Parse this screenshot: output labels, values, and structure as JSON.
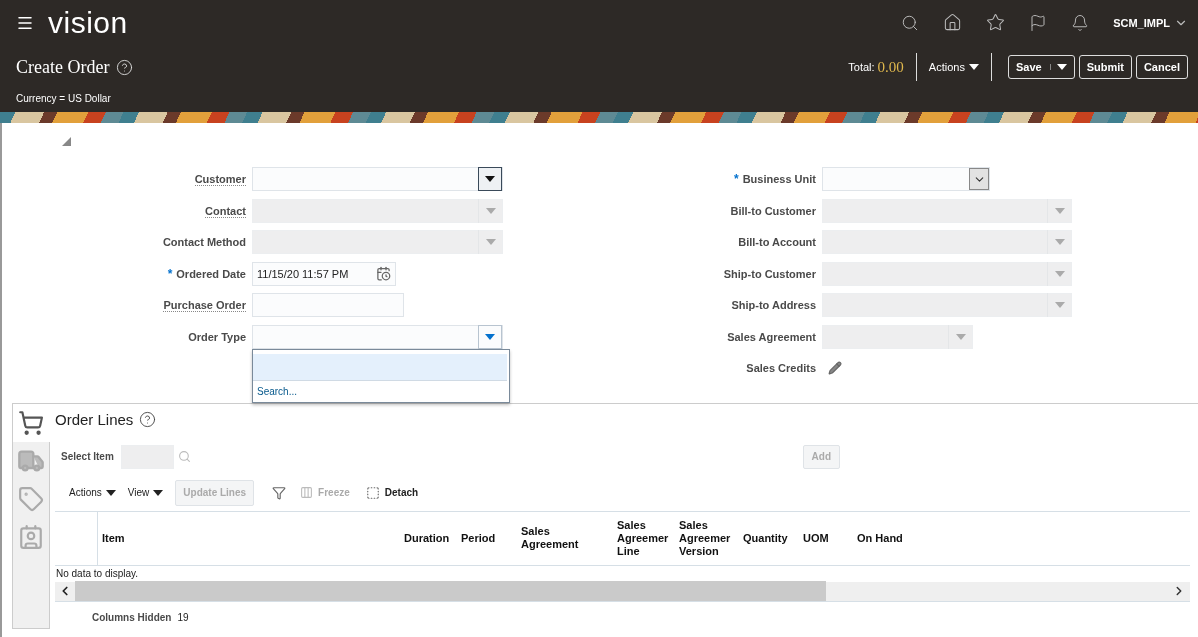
{
  "header": {
    "logo": "vision",
    "user": "SCM_IMPL"
  },
  "page": {
    "title": "Create Order",
    "total_label": "Total:",
    "total_value": "0.00",
    "actions_menu": "Actions",
    "currency": "Currency = US Dollar",
    "buttons": [
      {
        "label": "Save",
        "kind": "split"
      },
      {
        "label": "Submit",
        "kind": "plain"
      },
      {
        "label": "Cancel",
        "kind": "plain"
      }
    ]
  },
  "form": {
    "required_mark": "*",
    "left": [
      {
        "label": "Customer",
        "kind": "select",
        "required": false,
        "help": true,
        "disabled": false,
        "hovered": true,
        "open": false
      },
      {
        "label": "Contact",
        "kind": "select",
        "required": false,
        "help": true,
        "disabled": true,
        "hovered": false,
        "open": false
      },
      {
        "label": "Contact Method",
        "kind": "select",
        "required": false,
        "help": false,
        "disabled": true,
        "hovered": false,
        "open": false
      },
      {
        "label": "Ordered Date",
        "kind": "date",
        "required": true,
        "help": false,
        "disabled": false,
        "value": "11/15/20 11:57 PM"
      },
      {
        "label": "Purchase Order",
        "kind": "text",
        "required": false,
        "help": true,
        "disabled": false
      },
      {
        "label": "Order Type",
        "kind": "select",
        "required": false,
        "help": false,
        "disabled": false,
        "hovered": false,
        "open": true,
        "menu_link": "Search..."
      }
    ],
    "right": [
      {
        "label": "Business Unit",
        "kind": "combo",
        "required": true,
        "help": false,
        "disabled": false
      },
      {
        "label": "Bill-to Customer",
        "kind": "select",
        "required": false,
        "help": false,
        "disabled": true,
        "hovered": false,
        "open": false
      },
      {
        "label": "Bill-to Account",
        "kind": "select",
        "required": false,
        "help": false,
        "disabled": true,
        "hovered": false,
        "open": false
      },
      {
        "label": "Ship-to Customer",
        "kind": "select",
        "required": false,
        "help": false,
        "disabled": true,
        "hovered": false,
        "open": false
      },
      {
        "label": "Ship-to Address",
        "kind": "select",
        "required": false,
        "help": false,
        "disabled": true,
        "hovered": false,
        "open": false
      },
      {
        "label": "Sales Agreement",
        "kind": "select",
        "required": false,
        "help": false,
        "disabled": true,
        "hovered": false,
        "open": false
      },
      {
        "label": "Sales Credits",
        "kind": "edit",
        "required": false,
        "help": false
      }
    ]
  },
  "order_lines": {
    "title": "Order Lines",
    "side_tabs": [
      {
        "kind": "cart",
        "selected": true
      },
      {
        "kind": "truck",
        "selected": false
      },
      {
        "kind": "tag",
        "selected": false
      },
      {
        "kind": "contact",
        "selected": false
      }
    ],
    "select_item_label": "Select Item",
    "add_button": {
      "label": "Add",
      "disabled": true
    },
    "toolbar": [
      {
        "kind": "menu",
        "label": "Actions",
        "disabled": false
      },
      {
        "kind": "menu",
        "label": "View",
        "disabled": false
      },
      {
        "kind": "button",
        "label": "Update Lines",
        "disabled": true
      },
      {
        "kind": "filter",
        "disabled": false
      },
      {
        "kind": "freeze",
        "label": "Freeze",
        "disabled": true
      },
      {
        "kind": "detach",
        "label": "Detach",
        "disabled": false
      }
    ],
    "columns": [
      "Item",
      "Duration",
      "Period",
      "Sales Agreement",
      "Sales Agreemer Line",
      "Sales Agreemer Version",
      "Quantity",
      "UOM",
      "On Hand"
    ],
    "empty_text": "No data to display.",
    "hidden_label": "Columns Hidden",
    "hidden_count": "19"
  }
}
